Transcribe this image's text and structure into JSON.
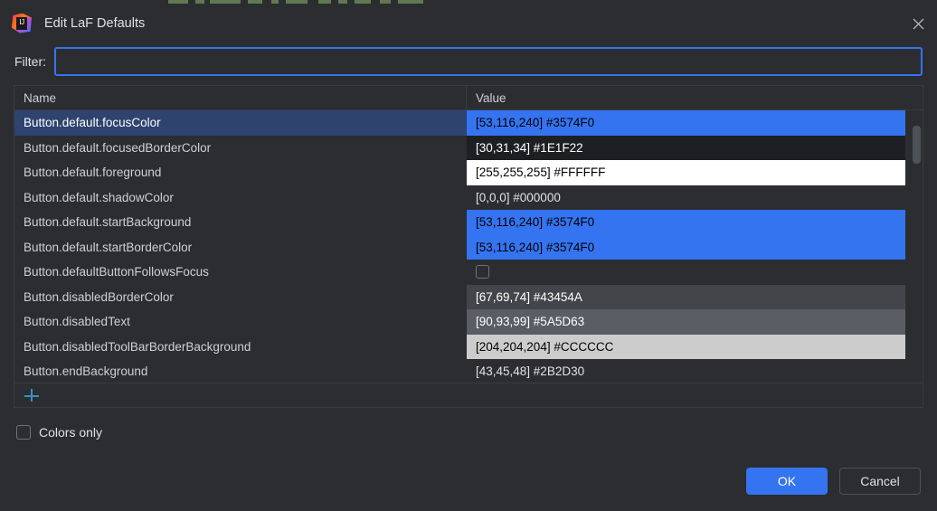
{
  "window": {
    "title": "Edit LaF Defaults",
    "app_icon": "intellij-idea-icon",
    "close_icon": "close-icon"
  },
  "filter": {
    "label": "Filter:",
    "value": "",
    "placeholder": ""
  },
  "table": {
    "columns": [
      "Name",
      "Value"
    ],
    "rows": [
      {
        "name": "Button.default.focusColor",
        "value": "[53,116,240] #3574F0",
        "swatch": "#3574F0",
        "text_color": "#000000",
        "selected": true,
        "type": "color"
      },
      {
        "name": "Button.default.focusedBorderColor",
        "value": "[30,31,34] #1E1F22",
        "swatch": "#1E1F22",
        "text_color": "#FFFFFF",
        "selected": false,
        "type": "color"
      },
      {
        "name": "Button.default.foreground",
        "value": "[255,255,255] #FFFFFF",
        "swatch": "#FFFFFF",
        "text_color": "#000000",
        "selected": false,
        "type": "color"
      },
      {
        "name": "Button.default.shadowColor",
        "value": "[0,0,0] #000000",
        "swatch": "#2B2D30",
        "text_color": "#DFE1E5",
        "selected": false,
        "type": "color"
      },
      {
        "name": "Button.default.startBackground",
        "value": "[53,116,240] #3574F0",
        "swatch": "#3574F0",
        "text_color": "#000000",
        "selected": false,
        "type": "color"
      },
      {
        "name": "Button.default.startBorderColor",
        "value": "[53,116,240] #3574F0",
        "swatch": "#3574F0",
        "text_color": "#000000",
        "selected": false,
        "type": "color"
      },
      {
        "name": "Button.defaultButtonFollowsFocus",
        "value": "",
        "swatch": "",
        "text_color": "#DFE1E5",
        "selected": false,
        "type": "checkbox"
      },
      {
        "name": "Button.disabledBorderColor",
        "value": "[67,69,74] #43454A",
        "swatch": "#43454A",
        "text_color": "#FFFFFF",
        "selected": false,
        "type": "color"
      },
      {
        "name": "Button.disabledText",
        "value": "[90,93,99] #5A5D63",
        "swatch": "#5A5D63",
        "text_color": "#FFFFFF",
        "selected": false,
        "type": "color"
      },
      {
        "name": "Button.disabledToolBarBorderBackground",
        "value": "[204,204,204] #CCCCCC",
        "swatch": "#CCCCCC",
        "text_color": "#000000",
        "selected": false,
        "type": "color"
      },
      {
        "name": "Button.endBackground",
        "value": "[43,45,48] #2B2D30",
        "swatch": "#2B2D30",
        "text_color": "#DFE1E5",
        "selected": false,
        "type": "color"
      }
    ]
  },
  "toolbar": {
    "add_label": "+",
    "add_icon": "plus-icon"
  },
  "options": {
    "colors_only_label": "Colors only",
    "colors_only_checked": false
  },
  "footer": {
    "ok_label": "OK",
    "cancel_label": "Cancel"
  },
  "colors": {
    "accent": "#3574F0",
    "dialog_bg": "#2B2D30",
    "selection_bg": "#2E436E",
    "border": "#393B40",
    "plus_icon": "#3592C4",
    "text": "#DFE1E5"
  }
}
